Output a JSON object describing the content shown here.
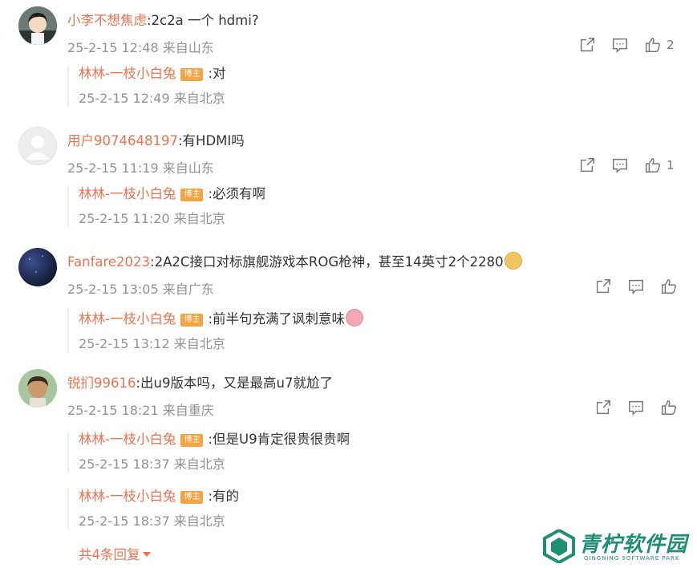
{
  "comments": [
    {
      "user": "小李不想焦虑",
      "text": ":2c2a 一个 hdmi?",
      "time": "25-2-15 12:48 来自山东",
      "likes": "2",
      "replies": [
        {
          "user": "林林-一枝小白兔",
          "badge": "博主",
          "text": ":对",
          "time": "25-2-15 12:49 来自北京"
        }
      ]
    },
    {
      "user": "用户9074648197",
      "text": ":有HDMI吗",
      "time": "25-2-15 11:19 来自山东",
      "likes": "1",
      "replies": [
        {
          "user": "林林-一枝小白兔",
          "badge": "博主",
          "text": ":必须有啊",
          "time": "25-2-15 11:20 来自北京"
        }
      ]
    },
    {
      "user": "Fanfare2023",
      "text": ":2A2C接口对标旗舰游戏本ROG枪神，甚至14英寸2个2280",
      "time": "25-2-15 13:05 来自广东",
      "likes": "",
      "replies": [
        {
          "user": "林林-一枝小白兔",
          "badge": "博主",
          "text": ":前半句充满了讽刺意味",
          "time": "25-2-15 13:12 来自北京"
        }
      ]
    },
    {
      "user": "锐扪99616",
      "text": ":出u9版本吗，又是最高u7就尬了",
      "time": "25-2-15 18:21 来自重庆",
      "likes": "",
      "replies": [
        {
          "user": "林林-一枝小白兔",
          "badge": "博主",
          "text": ":但是U9肯定很贵很贵啊",
          "time": "25-2-15 18:37 来自北京"
        },
        {
          "user": "林林-一枝小白兔",
          "badge": "博主",
          "text": ":有的",
          "time": "25-2-15 18:37 来自北京"
        }
      ],
      "more_replies": "共4条回复"
    }
  ],
  "icons": {
    "share": "share-icon",
    "comment": "comment-icon",
    "like": "thumbs-up-icon",
    "expand": "triangle-down-icon"
  },
  "watermark": {
    "title": "青柠软件园",
    "subtitle": "QINGNING SOFTWARE PARK"
  },
  "colors": {
    "username": "#eb7350",
    "meta": "#939393",
    "badge": "#f7a440",
    "watermark": "#1e8f73"
  }
}
